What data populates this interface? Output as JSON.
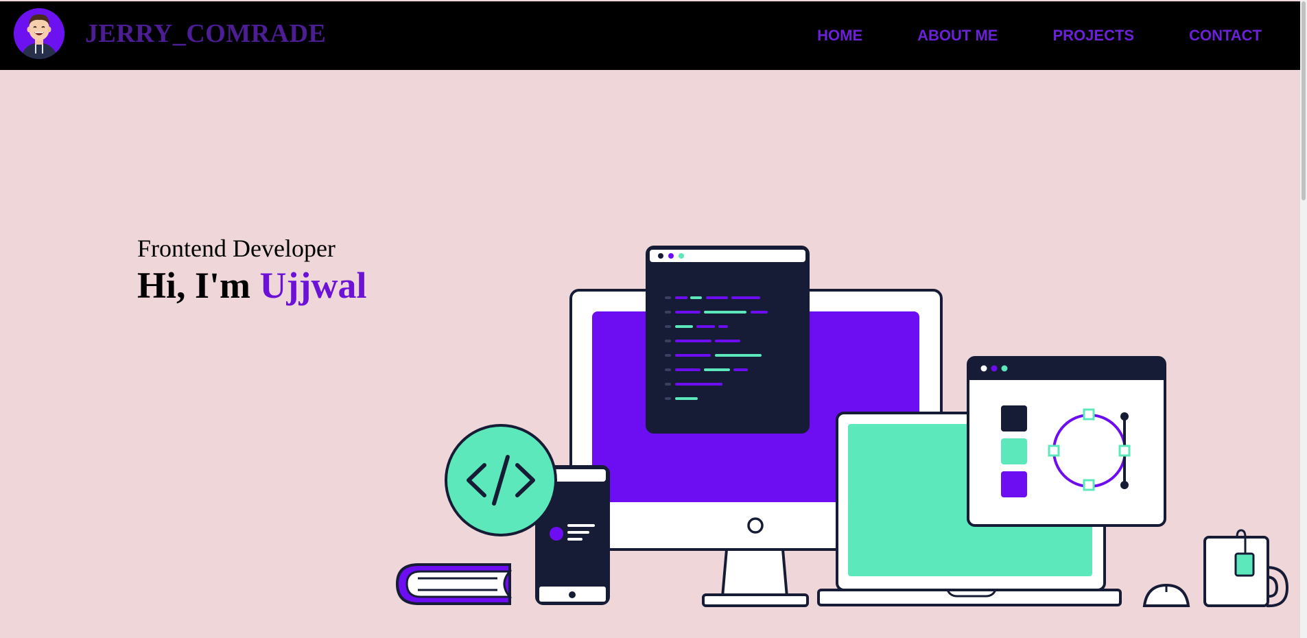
{
  "navbar": {
    "brand_name": "JERRY_COMRADE",
    "links": [
      {
        "label": "HOME"
      },
      {
        "label": "ABOUT ME"
      },
      {
        "label": "PROJECTS"
      },
      {
        "label": "CONTACT"
      }
    ]
  },
  "hero": {
    "subtitle": "Frontend Developer",
    "greeting": "Hi, I'm ",
    "name": "Ujjwal"
  },
  "colors": {
    "background": "#efd6d8",
    "navbar": "#000000",
    "accent": "#6b12d6",
    "mint": "#5ce8bb",
    "navy": "#161c35"
  },
  "icons": {
    "avatar": "avatar-illustration",
    "code": "code-brackets-icon"
  }
}
